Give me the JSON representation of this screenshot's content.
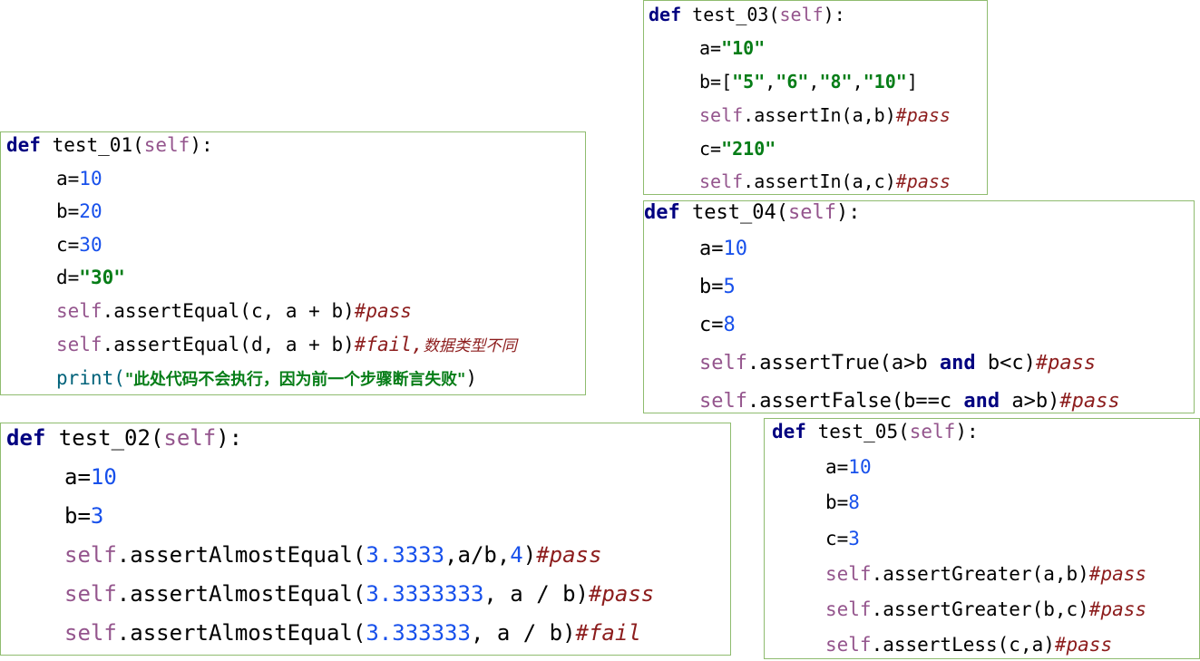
{
  "blocks": {
    "test_01": {
      "def": "def",
      "name": " test_01(",
      "self": "self",
      "close": "):",
      "lines": {
        "a": {
          "var": "a=",
          "val": "10"
        },
        "b": {
          "var": "b=",
          "val": "20"
        },
        "c": {
          "var": "c=",
          "val": "30"
        },
        "d": {
          "var": "d=",
          "val": "\"30\""
        },
        "assert1": {
          "self": "self",
          "call": ".assertEqual(c, a + b)",
          "comment": "#pass"
        },
        "assert2": {
          "self": "self",
          "call": ".assertEqual(d, a + b)",
          "comment": "#fail,",
          "comment_cn": "数据类型不同"
        },
        "print": {
          "func": "print(",
          "str": "\"此处代码不会执行，因为前一个步骤断言失败\"",
          "close": ")"
        }
      }
    },
    "test_02": {
      "def": "def",
      "name": " test_02(",
      "self": "self",
      "close": "):",
      "lines": {
        "a": {
          "var": "a=",
          "val": "10"
        },
        "b": {
          "var": "b=",
          "val": "3"
        },
        "assert1": {
          "self": "self",
          "call": ".assertAlmostEqual(",
          "n1": "3.3333",
          "mid": ",a/b,",
          "n2": "4",
          "tail": ")",
          "comment": "#pass"
        },
        "assert2": {
          "self": "self",
          "call": ".assertAlmostEqual(",
          "n1": "3.3333333",
          "tail": ", a / b)",
          "comment": "#pass"
        },
        "assert3": {
          "self": "self",
          "call": ".assertAlmostEqual(",
          "n1": "3.333333",
          "tail": ", a / b)",
          "comment": "#fail"
        }
      }
    },
    "test_03": {
      "def": "def",
      "name": " test_03(",
      "self": "self",
      "close": "):",
      "lines": {
        "a": {
          "var": "a=",
          "val": "\"10\""
        },
        "b": {
          "var": "b=[",
          "v1": "\"5\"",
          "v2": "\"6\"",
          "v3": "\"8\"",
          "v4": "\"10\"",
          "comma": ",",
          "close": "]"
        },
        "assert1": {
          "self": "self",
          "call": ".assertIn(a,b)",
          "comment": "#pass"
        },
        "c": {
          "var": "c=",
          "val": "\"210\""
        },
        "assert2": {
          "self": "self",
          "call": ".assertIn(a,c)",
          "comment": "#pass"
        }
      }
    },
    "test_04": {
      "def": "def",
      "name": " test_04(",
      "self": "self",
      "close": "):",
      "lines": {
        "a": {
          "var": "a=",
          "val": "10"
        },
        "b": {
          "var": "b=",
          "val": "5"
        },
        "c": {
          "var": "c=",
          "val": "8"
        },
        "assert1": {
          "self": "self",
          "call1": ".assertTrue(a>b ",
          "and": "and",
          "call2": " b<c)",
          "comment": "#pass"
        },
        "assert2": {
          "self": "self",
          "call1": ".assertFalse(b==c ",
          "and": "and",
          "call2": " a>b)",
          "comment": "#pass"
        }
      }
    },
    "test_05": {
      "def": "def",
      "name": " test_05(",
      "self": "self",
      "close": "):",
      "lines": {
        "a": {
          "var": "a=",
          "val": "10"
        },
        "b": {
          "var": "b=",
          "val": "8"
        },
        "c": {
          "var": "c=",
          "val": "3"
        },
        "assert1": {
          "self": "self",
          "call": ".assertGreater(a,b)",
          "comment": "#pass"
        },
        "assert2": {
          "self": "self",
          "call": ".assertGreater(b,c)",
          "comment": "#pass"
        },
        "assert3": {
          "self": "self",
          "call": ".assertLess(c,a)",
          "comment": "#pass"
        }
      }
    }
  },
  "colors": {
    "keyword": "#000080",
    "self": "#94558d",
    "number": "#1750eb",
    "string": "#067d17",
    "comment": "#8c1c1c",
    "border": "#8fbc6f"
  }
}
